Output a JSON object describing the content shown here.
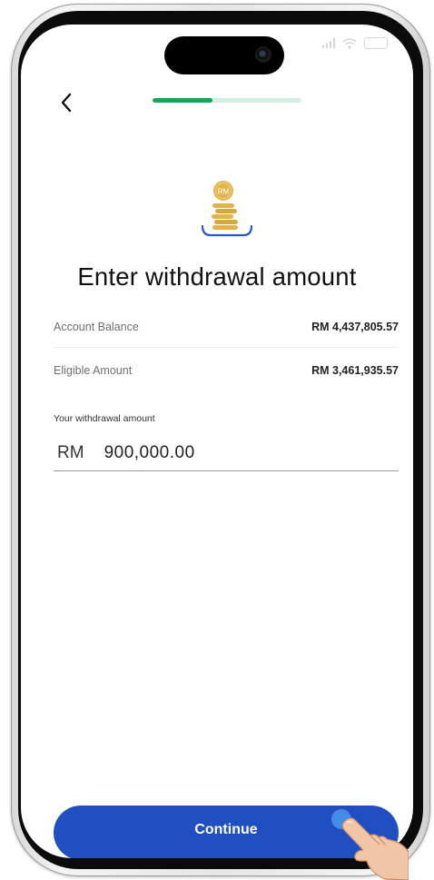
{
  "screen": {
    "title": "Enter withdrawal amount",
    "progress_fraction": 0.4
  },
  "navigation": {
    "back_icon": "chevron-left-icon"
  },
  "summary": {
    "account_balance_label": "Account Balance",
    "account_balance_value": "RM 4,437,805.57",
    "eligible_amount_label": "Eligible Amount",
    "eligible_amount_value": "RM 3,461,935.57"
  },
  "withdrawal": {
    "label": "Your withdrawal amount",
    "currency": "RM",
    "amount": "900,000.00"
  },
  "coin_icon": {
    "name": "coin-stack-icon",
    "text": "RM"
  },
  "actions": {
    "continue_label": "Continue"
  },
  "colors": {
    "primary_button": "#1f4fc1",
    "progress_active": "#16a65a",
    "progress_track": "#d4efe1",
    "coin_gold": "#e2b54a"
  }
}
